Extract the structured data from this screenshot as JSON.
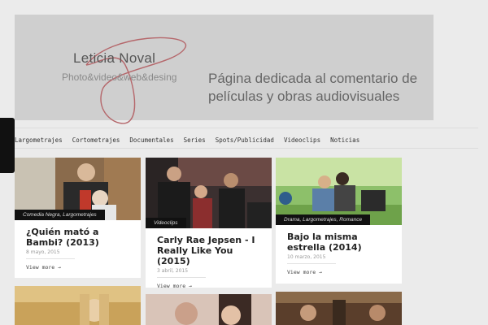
{
  "header": {
    "logo_name": "Leticia Noval",
    "logo_sub": "Photo&video&web&desing",
    "tagline": "Página dedicada al comentario de películas y obras audiovisuales"
  },
  "nav": {
    "items": [
      "Largometrajes",
      "Cortometrajes",
      "Documentales",
      "Series",
      "Spots/Publicidad",
      "Videoclips",
      "Noticias"
    ]
  },
  "posts": [
    {
      "category": "Comedia Negra, Largometrajes",
      "title": "¿Quién mató a Bambi? (2013)",
      "date": "8 mayo, 2015",
      "more": "View more →"
    },
    {
      "category": "Videoclips",
      "title": "Carly Rae Jepsen - I Really Like You (2015)",
      "date": "3 abril, 2015",
      "more": "View more →"
    },
    {
      "category": "Drama, Largometrajes, Romance",
      "title": "Bajo la misma estrella (2014)",
      "date": "10 marzo, 2015",
      "more": "View more →"
    }
  ],
  "colors": {
    "background": "#ebebeb",
    "banner": "#cfcfcf",
    "swirl": "#b5676b",
    "category_bg": "#111111"
  }
}
